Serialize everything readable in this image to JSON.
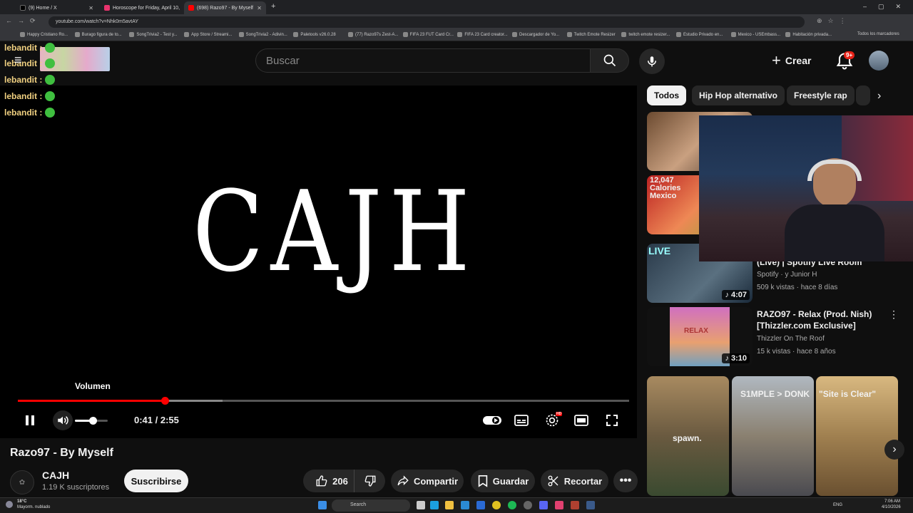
{
  "browser": {
    "tabs": [
      {
        "label": "(9) Home / X",
        "color": "#000000"
      },
      {
        "label": "Horoscope for Friday, April 10,",
        "color": "#e8336d"
      },
      {
        "label": "(698) Razo97 - By Myself",
        "color": "#ff0000"
      }
    ],
    "url": "youtube.com/watch?v=Nhk0m5avtAY",
    "bookmarks": [
      "Happy Cristiano Ro...",
      "Burago figura de to...",
      "SongTrivia2 - Test y...",
      "App Store / Streami...",
      "SongTrivia2 - Adivin...",
      "Paletools v26.0.28",
      "(77) Razo97s Zest-A...",
      "FIFA 23 FUT Card Cr...",
      "FIFA 23 Card creator...",
      "Descargador de Yo...",
      "Twitch Emote Resizer",
      "twitch emote resizer...",
      "Estudio Privado en...",
      "Mexico - USEmbass...",
      "Habitación privada..."
    ],
    "all_bookmarks": "Todos los marcadores"
  },
  "header": {
    "search_placeholder": "Buscar",
    "create_label": "Crear",
    "notif_badge": "9+"
  },
  "chat": {
    "messages": [
      {
        "user": "lebandit :"
      },
      {
        "user": "lebandit :"
      },
      {
        "user": "lebandit :"
      },
      {
        "user": "lebandit :"
      },
      {
        "user": "lebandit :"
      }
    ]
  },
  "player": {
    "overlay_text": "CAJH",
    "tooltip": "Volumen",
    "time": "0:41 / 2:55",
    "progress": 0.24,
    "volume": 0.55
  },
  "video": {
    "title": "Razo97 - By Myself",
    "channel": "CAJH",
    "subscribers": "1.19 K suscriptores",
    "subscribe_label": "Suscribirse",
    "likes": "206",
    "share_label": "Compartir",
    "save_label": "Guardar",
    "clip_label": "Recortar"
  },
  "chips": [
    "Todos",
    "Hip Hop alternativo",
    "Freestyle rap"
  ],
  "recommendations": [
    {
      "thumb_text": "",
      "duration": ""
    },
    {
      "thumb_text": "12,047 Calories Mexico",
      "duration": ""
    },
    {
      "title": "(Live) | Spotify Live Room",
      "channel": "Spotify · y Junior H",
      "meta": "509 k vistas · hace 8 días",
      "duration": "4:07",
      "thumb_text": "LIVE"
    },
    {
      "title": "RAZO97 - Relax (Prod. Nish) [Thizzler.com Exclusive]",
      "channel": "Thizzler On The Roof",
      "meta": "15 k vistas · hace 8 años",
      "duration": "3:10",
      "thumb_text": "RELAX"
    }
  ],
  "shorts": [
    {
      "caption": "spawn."
    },
    {
      "caption": "S1MPLE > DONK"
    },
    {
      "caption": "\"Site is Clear\""
    }
  ],
  "taskbar": {
    "weather_temp": "18°C",
    "weather_desc": "Mayorm. nublado",
    "search": "Search",
    "lang": "ENG",
    "time": "7:06 AM",
    "date": "4/10/2026"
  }
}
